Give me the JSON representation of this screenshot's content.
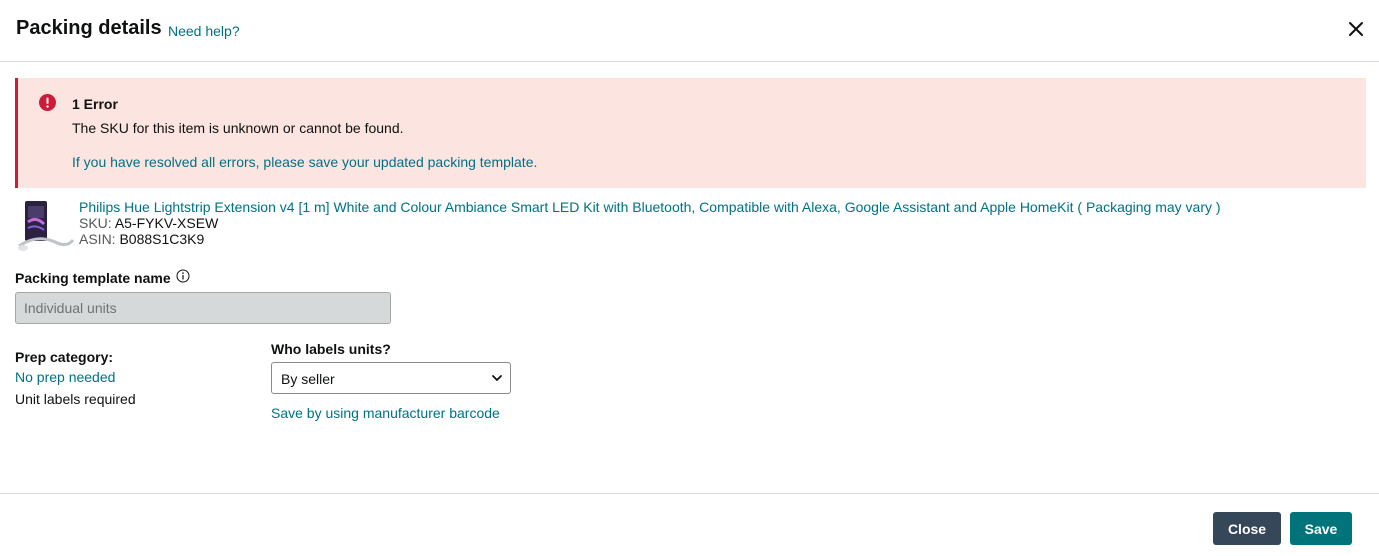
{
  "header": {
    "title": "Packing details",
    "help_link": "Need help?",
    "close_icon": "close-icon"
  },
  "error": {
    "icon": "error-icon",
    "title": "1 Error",
    "message": "The SKU for this item is unknown or cannot be found.",
    "hint": "If you have resolved all errors, please save your updated packing template."
  },
  "product": {
    "image_icon": "product-image",
    "title": "Philips Hue Lightstrip Extension v4 [1 m] White and Colour Ambiance Smart LED Kit with Bluetooth, Compatible with Alexa, Google Assistant and Apple HomeKit ( Packaging may vary )",
    "sku_label": "SKU:",
    "sku": "A5-FYKV-XSEW",
    "asin_label": "ASIN:",
    "asin": "B088S1C3K9"
  },
  "template": {
    "label": "Packing template name",
    "info_icon": "info-icon",
    "placeholder": "Individual units"
  },
  "prep": {
    "label": "Prep category:",
    "value": "No prep needed",
    "note": "Unit labels required"
  },
  "labels": {
    "label": "Who labels units?",
    "selected": "By seller",
    "chevron_icon": "chevron-down-icon",
    "barcode_link": "Save by using manufacturer barcode"
  },
  "footer": {
    "close_label": "Close",
    "save_label": "Save"
  },
  "colors": {
    "link": "#007185",
    "error_bg": "#fce4e0",
    "error_accent": "#cc1c39",
    "close_button": "#37475a",
    "save_button": "#00747a"
  }
}
